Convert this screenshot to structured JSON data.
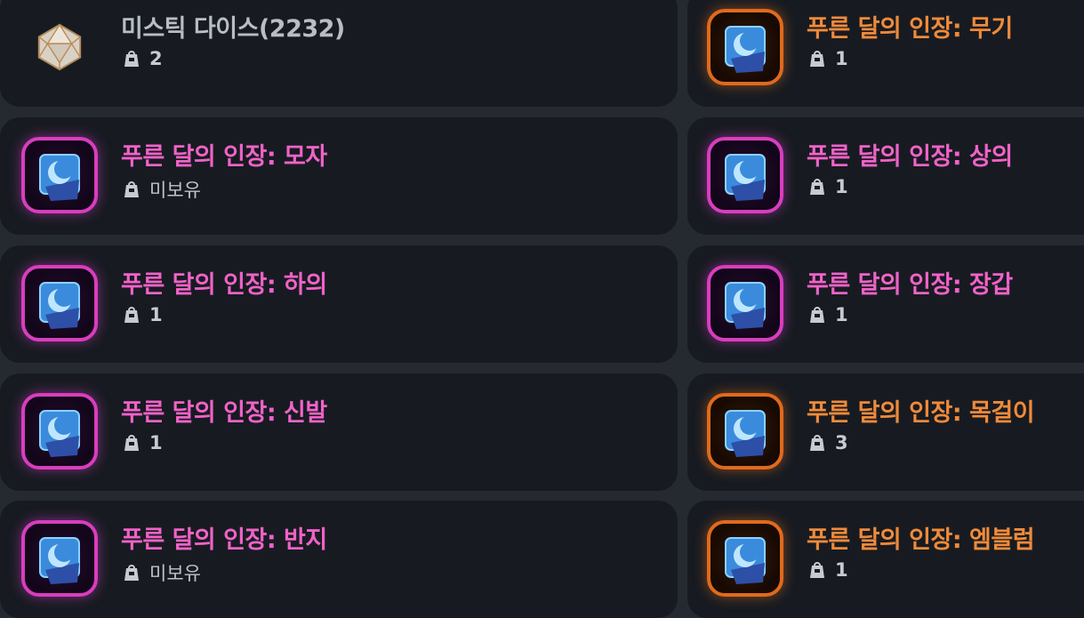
{
  "items": [
    {
      "name": "미스틱 다이스(2232)",
      "count": "2",
      "grade": "gray",
      "icon": "dice-icon",
      "col": 0
    },
    {
      "name": "푸른 달의 인장: 무기",
      "count": "1",
      "grade": "orange",
      "icon": "blue-moon-seal-icon",
      "col": 1
    },
    {
      "name": "푸른 달의 인장: 모자",
      "count": "미보유",
      "grade": "pink",
      "icon": "blue-moon-seal-icon",
      "col": 0
    },
    {
      "name": "푸른 달의 인장: 상의",
      "count": "1",
      "grade": "pink",
      "icon": "blue-moon-seal-icon",
      "col": 1
    },
    {
      "name": "푸른 달의 인장: 하의",
      "count": "1",
      "grade": "pink",
      "icon": "blue-moon-seal-icon",
      "col": 0
    },
    {
      "name": "푸른 달의 인장: 장갑",
      "count": "1",
      "grade": "pink",
      "icon": "blue-moon-seal-icon",
      "col": 1
    },
    {
      "name": "푸른 달의 인장: 신발",
      "count": "1",
      "grade": "pink",
      "icon": "blue-moon-seal-icon",
      "col": 0
    },
    {
      "name": "푸른 달의 인장: 목걸이",
      "count": "3",
      "grade": "orange",
      "icon": "blue-moon-seal-icon",
      "col": 1
    },
    {
      "name": "푸른 달의 인장: 반지",
      "count": "미보유",
      "grade": "pink",
      "icon": "blue-moon-seal-icon",
      "col": 0
    },
    {
      "name": "푸른 달의 인장: 엠블럼",
      "count": "1",
      "grade": "orange",
      "icon": "blue-moon-seal-icon",
      "col": 1
    }
  ],
  "owned_icon": "inventory-bag-icon",
  "colors": {
    "pink": "#f062c8",
    "orange": "#f08a3a",
    "gray": "#b9bdc4",
    "card_bg": "#171b21",
    "page_bg": "#252a31"
  }
}
